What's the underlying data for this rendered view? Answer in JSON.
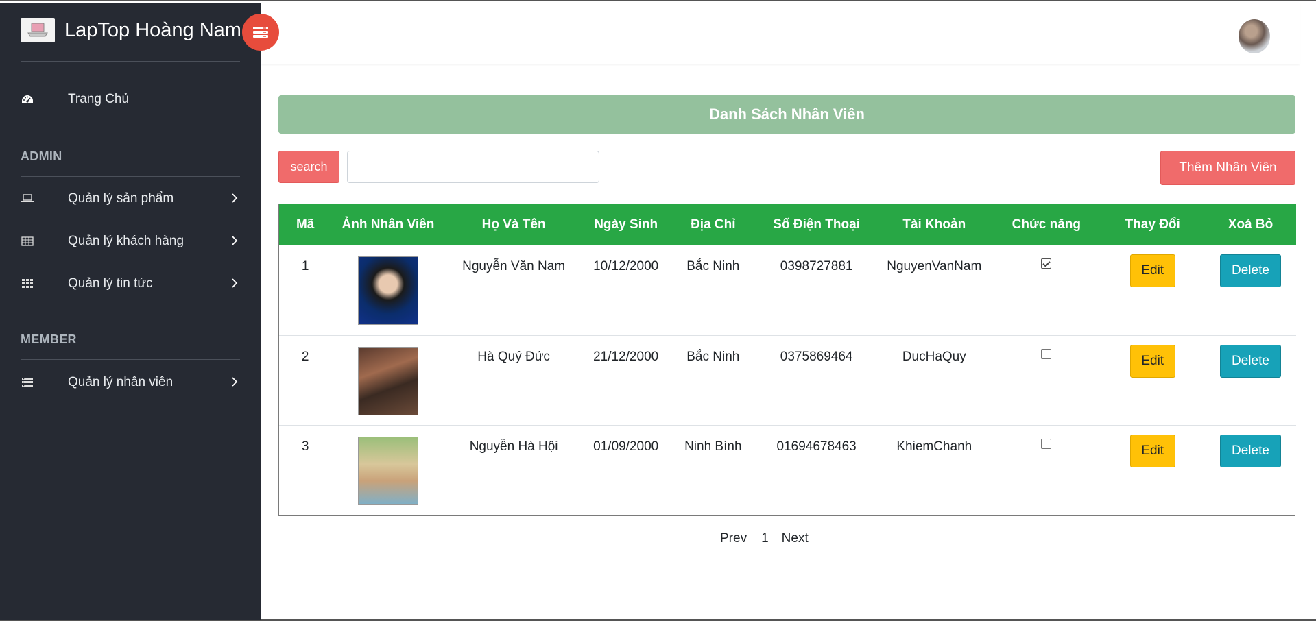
{
  "brand": {
    "title": "LapTop Hoàng Nam",
    "logo_icon": "laptop-icon"
  },
  "sidebar": {
    "home": {
      "label": "Trang Chủ",
      "icon": "dashboard-icon"
    },
    "admin_heading": "ADMIN",
    "admin_items": [
      {
        "label": "Quản lý sản phẩm",
        "icon": "laptop-icon"
      },
      {
        "label": "Quản lý khách hàng",
        "icon": "table-icon"
      },
      {
        "label": "Quản lý tin tức",
        "icon": "grid-icon"
      }
    ],
    "member_heading": "MEMBER",
    "member_items": [
      {
        "label": "Quản lý nhân viên",
        "icon": "server-icon"
      }
    ]
  },
  "main": {
    "title": "Danh Sách Nhân Viên",
    "search_label": "search",
    "search_value": "",
    "add_label": "Thêm Nhân Viên"
  },
  "table": {
    "headers": [
      "Mã",
      "Ảnh Nhân Viên",
      "Họ Và Tên",
      "Ngày Sinh",
      "Địa Chỉ",
      "Số Điện Thoại",
      "Tài Khoản",
      "Chức năng",
      "Thay Đổi",
      "Xoá Bỏ"
    ],
    "rows": [
      {
        "id": "1",
        "name": "Nguyễn Văn Nam",
        "dob": "10/12/2000",
        "address": "Bắc Ninh",
        "phone": "0398727881",
        "account": "NguyenVanNam",
        "role_checked": true,
        "edit": "Edit",
        "delete": "Delete"
      },
      {
        "id": "2",
        "name": "Hà Quý Đức",
        "dob": "21/12/2000",
        "address": "Bắc Ninh",
        "phone": "0375869464",
        "account": "DucHaQuy",
        "role_checked": false,
        "edit": "Edit",
        "delete": "Delete"
      },
      {
        "id": "3",
        "name": "Nguyễn Hà Hội",
        "dob": "01/09/2000",
        "address": "Ninh Bình",
        "phone": "01694678463",
        "account": "KhiemChanh",
        "role_checked": false,
        "edit": "Edit",
        "delete": "Delete"
      }
    ]
  },
  "pagination": {
    "prev": "Prev",
    "page": "1",
    "next": "Next"
  },
  "colors": {
    "sidebar": "#262a33",
    "title_bar": "#94c19d",
    "table_header": "#28a745",
    "danger_button": "#f06b6b",
    "edit_button": "#ffc107",
    "delete_button": "#17a2b8",
    "toggle": "#e74c3c"
  }
}
